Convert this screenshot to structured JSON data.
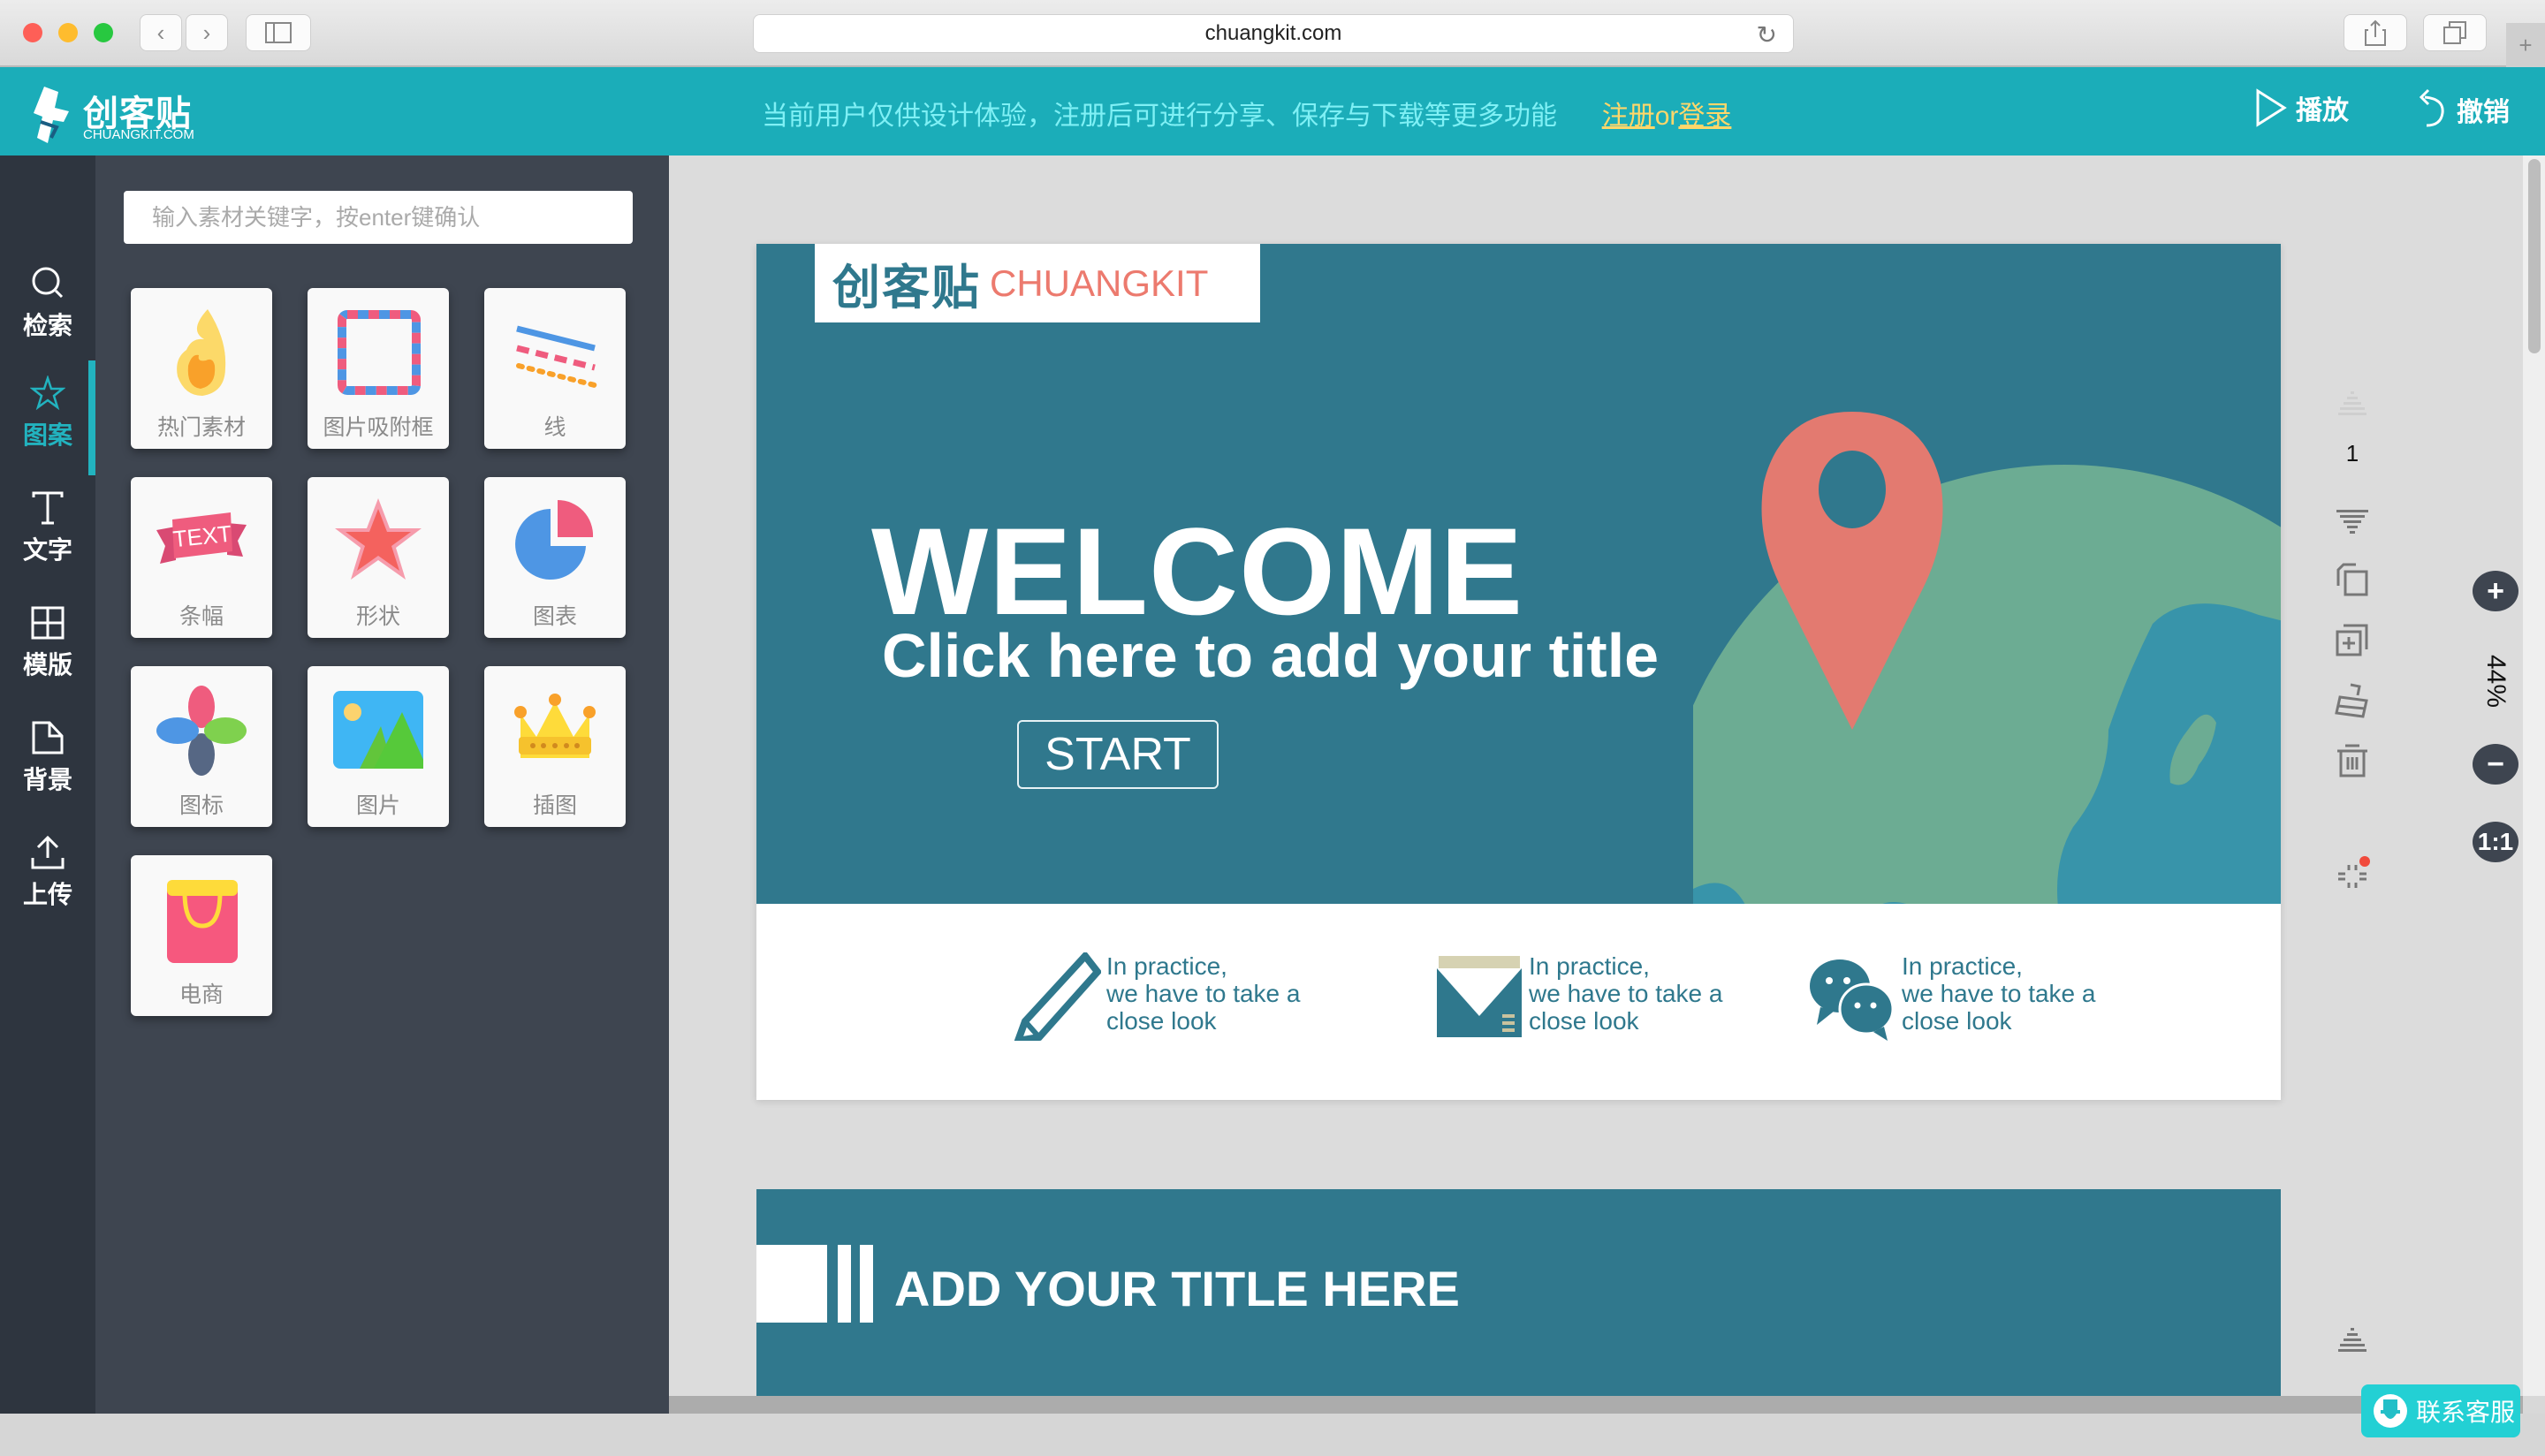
{
  "browser": {
    "url": "chuangkit.com",
    "back_icon": "chevron-left-icon",
    "forward_icon": "chevron-right-icon",
    "sidebar_icon": "sidebar-icon",
    "reload_icon": "reload-icon",
    "share_icon": "share-icon",
    "tabs_icon": "tabs-icon",
    "new_tab_label": "+"
  },
  "header": {
    "logo_cn": "创客贴",
    "logo_en": "CHUANGKIT.COM",
    "notice": "当前用户仅供设计体验，注册后可进行分享、保存与下载等更多功能",
    "register_label": "注册",
    "or_label": "or",
    "login_label": "登录",
    "play_label": "播放",
    "undo_label": "撤销"
  },
  "rail": {
    "items": [
      {
        "label": "检索",
        "icon": "search-icon",
        "active": false
      },
      {
        "label": "图案",
        "icon": "star-icon",
        "active": true
      },
      {
        "label": "文字",
        "icon": "text-icon",
        "active": false
      },
      {
        "label": "模版",
        "icon": "template-icon",
        "active": false
      },
      {
        "label": "背景",
        "icon": "background-icon",
        "active": false
      },
      {
        "label": "上传",
        "icon": "upload-icon",
        "active": false
      }
    ]
  },
  "panel": {
    "search_placeholder": "输入素材关键字，按enter键确认",
    "search_value": "",
    "tiles": [
      {
        "label": "热门素材",
        "icon": "flame-icon"
      },
      {
        "label": "图片吸附框",
        "icon": "photo-frame-icon"
      },
      {
        "label": "线",
        "icon": "lines-icon"
      },
      {
        "label": "条幅",
        "icon": "banner-icon"
      },
      {
        "label": "形状",
        "icon": "star-shape-icon"
      },
      {
        "label": "图表",
        "icon": "pie-chart-icon"
      },
      {
        "label": "图标",
        "icon": "petals-icon"
      },
      {
        "label": "图片",
        "icon": "image-icon"
      },
      {
        "label": "插图",
        "icon": "crown-icon"
      },
      {
        "label": "电商",
        "icon": "shopping-bag-icon"
      }
    ],
    "banner_tile_text": "TEXT"
  },
  "slide1": {
    "brand_cn": "创客贴",
    "brand_en": "CHUANGKIT",
    "welcome": "WELCOME",
    "subtitle": "Click here to add your title",
    "start_label": "START",
    "features": [
      {
        "icon": "pencil-icon",
        "line1": "In practice,",
        "line2": "we have to take a",
        "line3": "close look"
      },
      {
        "icon": "envelope-icon",
        "line1": "In practice,",
        "line2": "we have to take a",
        "line3": "close look"
      },
      {
        "icon": "wechat-icon",
        "line1": "In practice,",
        "line2": "we have to take a",
        "line3": "close look"
      }
    ]
  },
  "slide2": {
    "title": "ADD YOUR TITLE HERE"
  },
  "tools": {
    "page_number": "1",
    "zoom_level": "44%",
    "zoom_in_label": "+",
    "zoom_out_label": "−",
    "reset_label": "1:1"
  },
  "service": {
    "label": "联系客服"
  },
  "colors": {
    "brand_teal": "#1badb9",
    "slide_teal": "#30788d",
    "accent_coral": "#ec7a6e",
    "link_yellow": "#ffd76a"
  }
}
